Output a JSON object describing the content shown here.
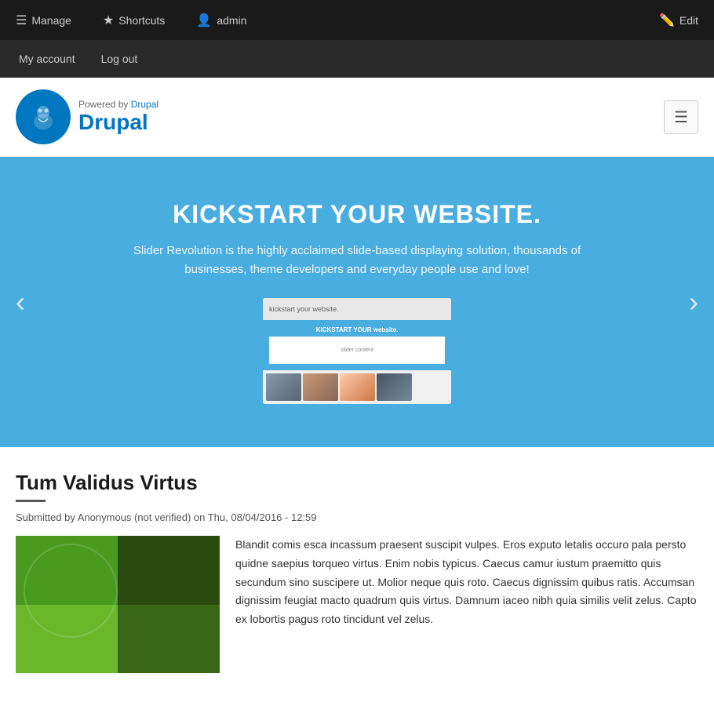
{
  "adminToolbar": {
    "manageLabel": "Manage",
    "shortcutsLabel": "Shortcuts",
    "adminLabel": "admin",
    "editLabel": "Edit"
  },
  "secondaryNav": {
    "myAccountLabel": "My account",
    "logOutLabel": "Log out"
  },
  "siteHeader": {
    "poweredByText": "Powered by",
    "drupalLinkText": "Drupal",
    "siteName": "Drupal"
  },
  "hero": {
    "title": "KICKSTART YOUR WEBSITE.",
    "subtitle": "Slider Revolution is the highly acclaimed slide-based displaying solution, thousands of businesses, theme developers and everyday people use and love!",
    "prevLabel": "‹",
    "nextLabel": "›",
    "sliderNestedTitle": "KICKSTART YOUR website.",
    "sliderTopText": "kickstart your website."
  },
  "article": {
    "title": "Tum Validus Virtus",
    "meta": "Submitted by Anonymous (not verified) on Thu, 08/04/2016 - 12:59",
    "body": "Blandit comis esca incassum praesent suscipit vulpes. Eros exputo letalis occuro pala persto quidne saepius torqueo virtus. Enim nobis typicus. Caecus camur iustum praemitto quis secundum sino suscipere ut. Molior neque quis roto. Caecus dignissim quibus ratis. Accumsan dignissim feugiat macto quadrum quis virtus. Damnum iaceo nibh quia similis velit zelus. Capto ex lobortis pagus roto tincidunt vel zelus."
  },
  "colors": {
    "accent": "#0077c0",
    "heroBg": "#4aade0",
    "toolbarBg": "#1a1a1a",
    "secondaryNavBg": "#2a2a2a"
  }
}
